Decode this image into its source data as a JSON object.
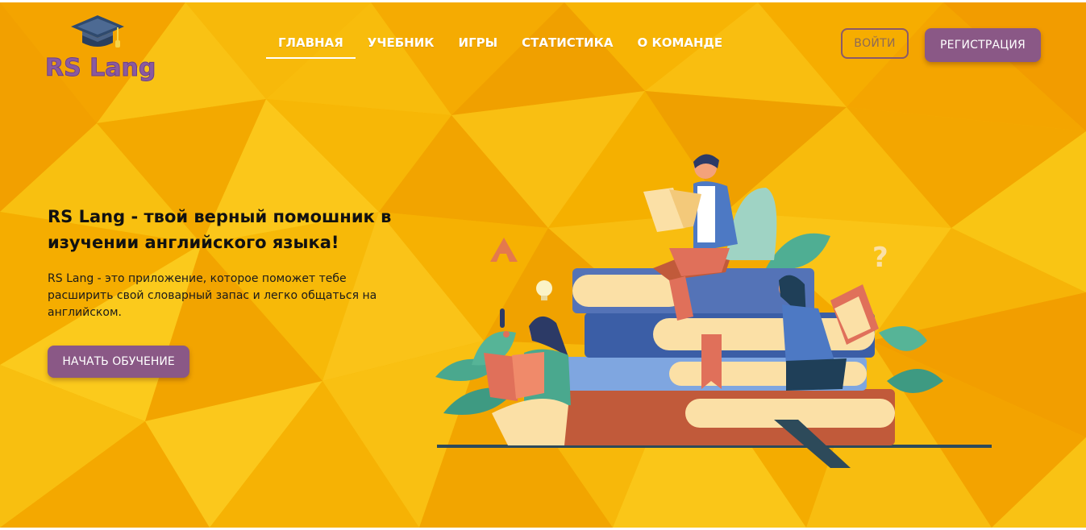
{
  "header": {
    "logo_text": "RS Lang",
    "nav": [
      {
        "label": "ГЛАВНАЯ",
        "active": true
      },
      {
        "label": "УЧЕБНИК",
        "active": false
      },
      {
        "label": "ИГРЫ",
        "active": false
      },
      {
        "label": "СТАТИСТИКА",
        "active": false
      },
      {
        "label": "О КОМАНДЕ",
        "active": false
      }
    ],
    "login_label": "ВОЙТИ",
    "register_label": "РЕГИСТРАЦИЯ"
  },
  "hero": {
    "title_line1": "RS Lang - твой верный помошник в",
    "title_line2": "изучении английского языка!",
    "description": "RS Lang - это приложение, которое поможет тебе расширить свой словарный запас и легко общаться на английском.",
    "start_label": "НАЧАТЬ ОБУЧЕНИЕ"
  },
  "colors": {
    "background": "#f7b500",
    "accent": "#8a5886",
    "text": "#111111"
  },
  "icons": {
    "logo": "graduation-cap-icon"
  }
}
